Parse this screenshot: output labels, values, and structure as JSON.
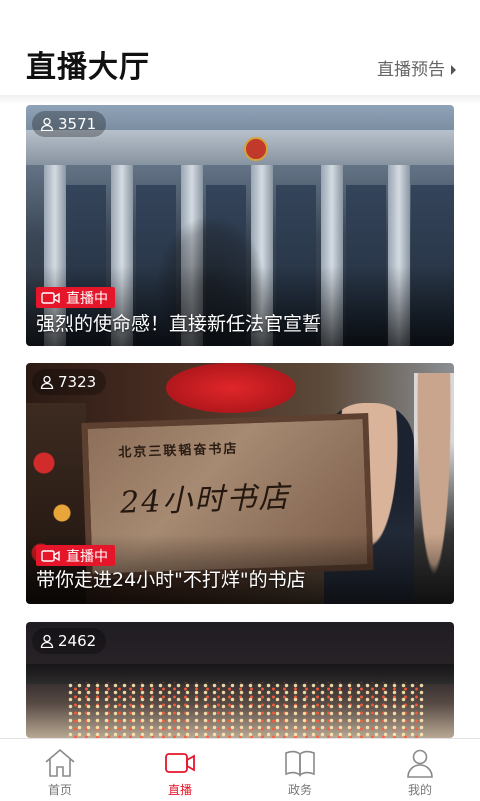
{
  "header": {
    "title": "直播大厅",
    "preview_label": "直播预告"
  },
  "cards": [
    {
      "viewers": "3571",
      "status": "直播中",
      "title": "强烈的使命感！直接新任法官宣誓"
    },
    {
      "viewers": "7323",
      "status": "直播中",
      "title": "带你走进24小时\"不打烊\"的书店",
      "plaque_top": "北京三联韬奋书店",
      "plaque_main": "24小时书店"
    },
    {
      "viewers": "2462"
    }
  ],
  "tabbar": {
    "items": [
      {
        "label": "首页",
        "icon": "home-icon",
        "active": false
      },
      {
        "label": "直播",
        "icon": "video-camera-icon",
        "active": true
      },
      {
        "label": "政务",
        "icon": "book-icon",
        "active": false
      },
      {
        "label": "我的",
        "icon": "user-icon",
        "active": false
      }
    ]
  },
  "colors": {
    "accent": "#e5162a",
    "tab_inactive": "#777777"
  }
}
